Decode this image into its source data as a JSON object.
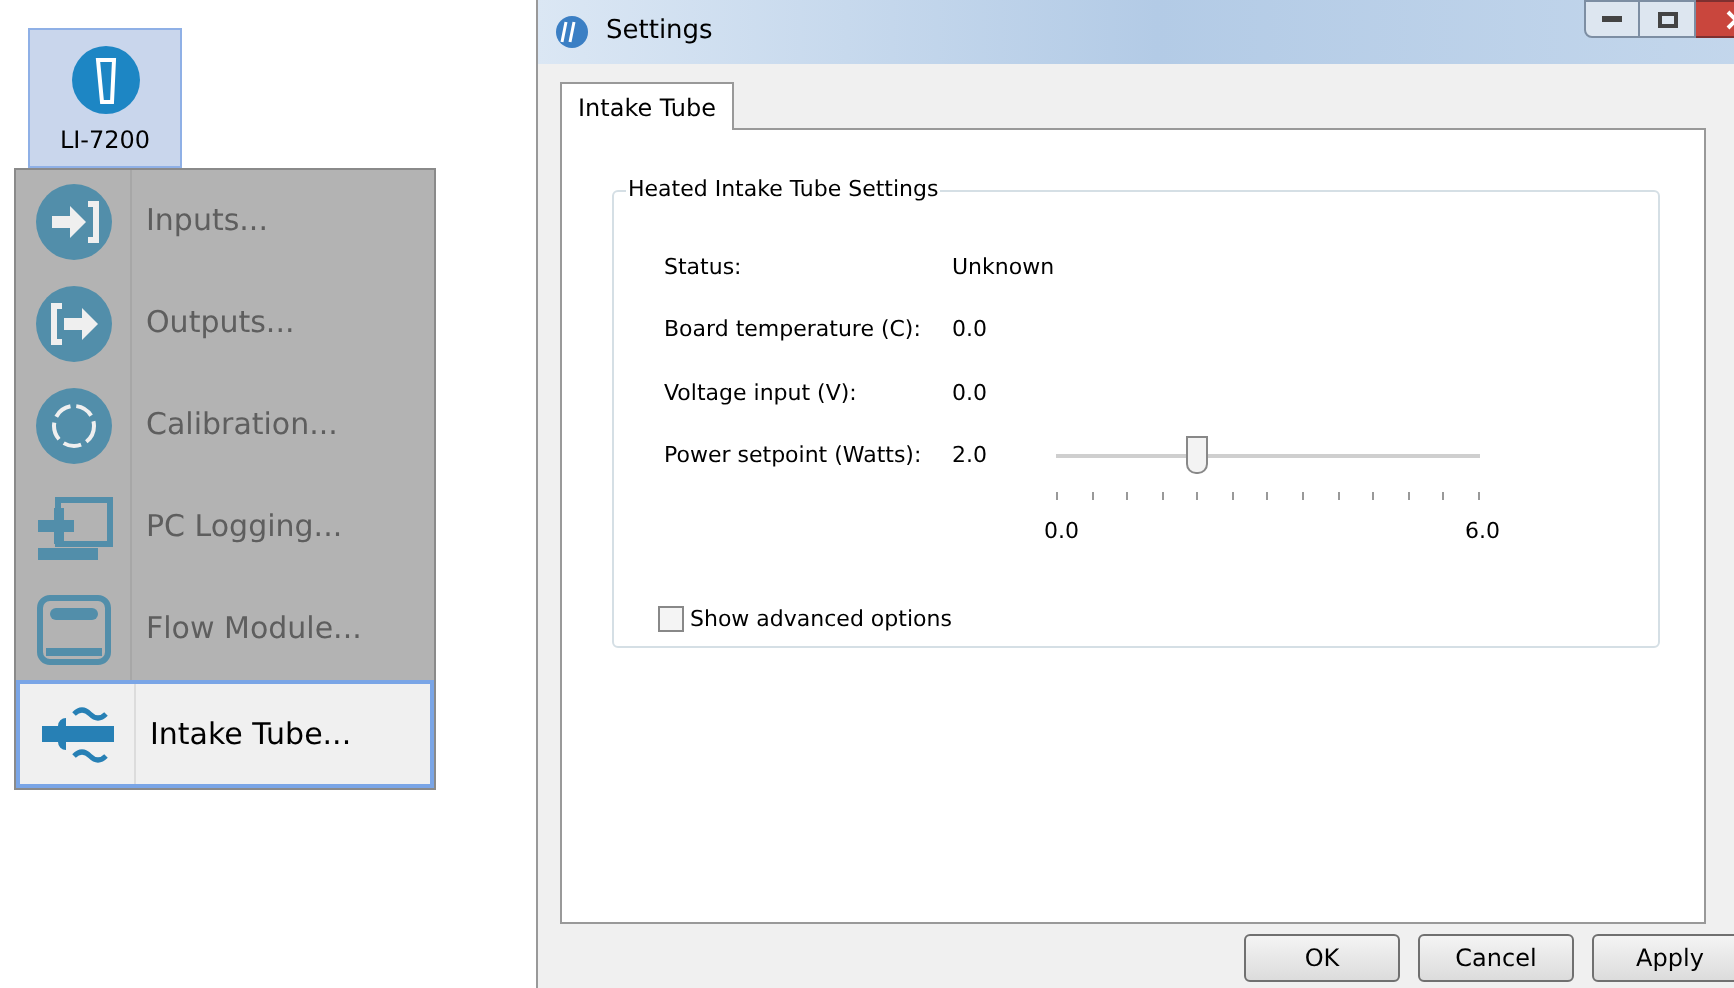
{
  "device": {
    "label": "LI-7200"
  },
  "menu": [
    {
      "label": "Inputs...",
      "selected": false
    },
    {
      "label": "Outputs...",
      "selected": false
    },
    {
      "label": "Calibration...",
      "selected": false
    },
    {
      "label": "PC Logging...",
      "selected": false
    },
    {
      "label": "Flow Module...",
      "selected": false
    },
    {
      "label": "Intake Tube...",
      "selected": true
    }
  ],
  "window": {
    "title": "Settings"
  },
  "tabs": [
    {
      "label": "Intake Tube",
      "selected": true
    }
  ],
  "group": {
    "title": "Heated Intake Tube Settings",
    "fields": [
      {
        "label": "Status:",
        "value": "Unknown"
      },
      {
        "label": "Board temperature (C):",
        "value": "0.0"
      },
      {
        "label": "Voltage input (V):",
        "value": "0.0"
      },
      {
        "label": "Power setpoint (Watts):",
        "value": "2.0"
      }
    ],
    "slider": {
      "level": 0.333,
      "min_label": "0.0",
      "max_label": "6.0"
    },
    "advanced": {
      "label": "Show advanced options",
      "checked": false
    }
  },
  "buttons": [
    "OK",
    "Cancel",
    "Apply"
  ]
}
